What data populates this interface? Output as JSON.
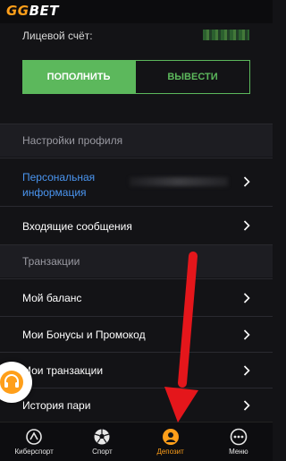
{
  "header": {
    "logo_part1": "GG",
    "logo_part2": "BET"
  },
  "account": {
    "label": "Лицевой счёт:"
  },
  "buttons": {
    "deposit": "ПОПОЛНИТЬ",
    "withdraw": "ВЫВЕСТИ"
  },
  "profile_section": {
    "title": "Настройки профиля",
    "personal_info": "Персональная информация",
    "messages": "Входящие сообщения"
  },
  "transactions_section": {
    "title": "Транзакции",
    "items": [
      "Мой баланс",
      "Мои Бонусы и Промокод",
      "Мои транзакции",
      "История пари"
    ]
  },
  "bottom_nav": {
    "items": [
      {
        "label": "Киберспорт",
        "icon": "esports-icon"
      },
      {
        "label": "Спорт",
        "icon": "soccer-ball-icon"
      },
      {
        "label": "Депозит",
        "icon": "user-icon",
        "active": true
      },
      {
        "label": "Меню",
        "icon": "more-icon"
      }
    ]
  },
  "colors": {
    "accent_green": "#5cb85c",
    "accent_orange": "#ff9f1a",
    "link_blue": "#4a95f0",
    "annotation_red": "#e4161b"
  }
}
